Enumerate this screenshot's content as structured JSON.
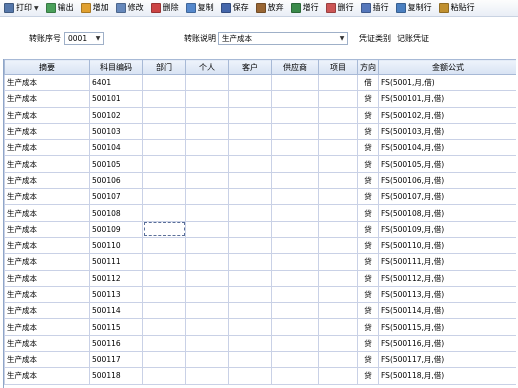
{
  "toolbar": [
    {
      "label": "打印",
      "icon": "printer-icon",
      "caret": true,
      "color": "#5577aa"
    },
    {
      "label": "输出",
      "icon": "export-icon",
      "color": "#4aa05a"
    },
    {
      "label": "增加",
      "icon": "add-icon",
      "color": "#e0a030"
    },
    {
      "label": "修改",
      "icon": "edit-icon",
      "color": "#6688bb"
    },
    {
      "label": "删除",
      "icon": "delete-icon",
      "color": "#cc4444"
    },
    {
      "label": "复制",
      "icon": "copy-icon",
      "color": "#5588cc"
    },
    {
      "label": "保存",
      "icon": "save-icon",
      "color": "#4466aa"
    },
    {
      "label": "放弃",
      "icon": "discard-icon",
      "color": "#996633"
    },
    {
      "label": "增行",
      "icon": "add-row-icon",
      "color": "#3a8a4a"
    },
    {
      "label": "删行",
      "icon": "delete-row-icon",
      "color": "#cc5555"
    },
    {
      "label": "插行",
      "icon": "insert-row-icon",
      "color": "#5577bb"
    },
    {
      "label": "复制行",
      "icon": "copy-row-icon",
      "color": "#4a7fc0"
    },
    {
      "label": "粘贴行",
      "icon": "paste-row-icon",
      "color": "#c09030"
    }
  ],
  "form": {
    "seq_label": "转账序号",
    "seq_value": "0001",
    "desc_label": "转账说明",
    "desc_value": "生产成本",
    "voucher_label": "凭证类别",
    "voucher_value": "记账凭证"
  },
  "columns": [
    "摘要",
    "科目编码",
    "部门",
    "个人",
    "客户",
    "供应商",
    "项目",
    "方向",
    "金额公式"
  ],
  "rows": [
    {
      "summary": "生产成本",
      "code": "6401",
      "dir": "借",
      "formula": "FS(5001,月,借)"
    },
    {
      "summary": "生产成本",
      "code": "500101",
      "dir": "贷",
      "formula": "FS(500101,月,借)"
    },
    {
      "summary": "生产成本",
      "code": "500102",
      "dir": "贷",
      "formula": "FS(500102,月,借)"
    },
    {
      "summary": "生产成本",
      "code": "500103",
      "dir": "贷",
      "formula": "FS(500103,月,借)"
    },
    {
      "summary": "生产成本",
      "code": "500104",
      "dir": "贷",
      "formula": "FS(500104,月,借)"
    },
    {
      "summary": "生产成本",
      "code": "500105",
      "dir": "贷",
      "formula": "FS(500105,月,借)"
    },
    {
      "summary": "生产成本",
      "code": "500106",
      "dir": "贷",
      "formula": "FS(500106,月,借)"
    },
    {
      "summary": "生产成本",
      "code": "500107",
      "dir": "贷",
      "formula": "FS(500107,月,借)"
    },
    {
      "summary": "生产成本",
      "code": "500108",
      "dir": "贷",
      "formula": "FS(500108,月,借)"
    },
    {
      "summary": "生产成本",
      "code": "500109",
      "dir": "贷",
      "formula": "FS(500109,月,借)"
    },
    {
      "summary": "生产成本",
      "code": "500110",
      "dir": "贷",
      "formula": "FS(500110,月,借)"
    },
    {
      "summary": "生产成本",
      "code": "500111",
      "dir": "贷",
      "formula": "FS(500111,月,借)"
    },
    {
      "summary": "生产成本",
      "code": "500112",
      "dir": "贷",
      "formula": "FS(500112,月,借)"
    },
    {
      "summary": "生产成本",
      "code": "500113",
      "dir": "贷",
      "formula": "FS(500113,月,借)"
    },
    {
      "summary": "生产成本",
      "code": "500114",
      "dir": "贷",
      "formula": "FS(500114,月,借)"
    },
    {
      "summary": "生产成本",
      "code": "500115",
      "dir": "贷",
      "formula": "FS(500115,月,借)"
    },
    {
      "summary": "生产成本",
      "code": "500116",
      "dir": "贷",
      "formula": "FS(500116,月,借)"
    },
    {
      "summary": "生产成本",
      "code": "500117",
      "dir": "贷",
      "formula": "FS(500117,月,借)"
    },
    {
      "summary": "生产成本",
      "code": "500118",
      "dir": "贷",
      "formula": "FS(500118,月,借)"
    }
  ]
}
